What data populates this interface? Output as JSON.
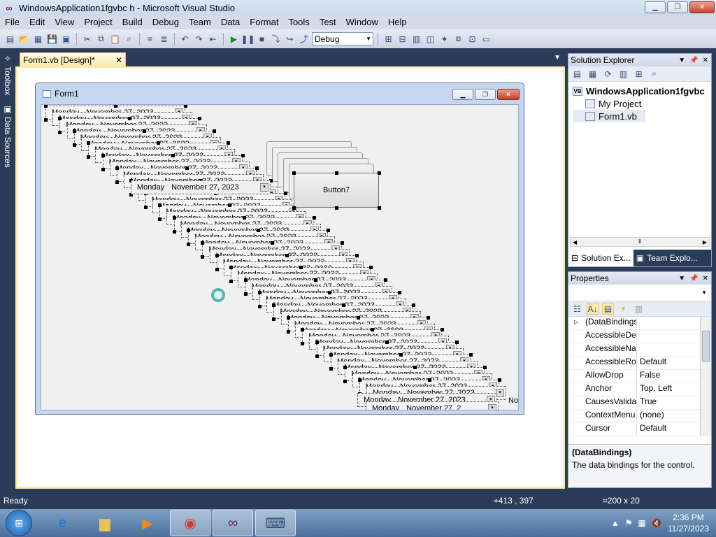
{
  "window": {
    "title": "WindowsApplication1fgvbc     h - Microsoft Visual Studio"
  },
  "menu": [
    "File",
    "Edit",
    "View",
    "Project",
    "Build",
    "Debug",
    "Team",
    "Data",
    "Format",
    "Tools",
    "Test",
    "Window",
    "Help"
  ],
  "toolbar": {
    "config_value": "Debug"
  },
  "side_tabs": {
    "toolbox": "Toolbox",
    "data_sources": "Data Sources"
  },
  "document": {
    "tab_label": "Form1.vb [Design]*"
  },
  "form": {
    "title": "Form1",
    "button_label": "Button7",
    "dtp_day": "Monday",
    "dtp_date": "November 27, 2023",
    "dtp_date_partial": "November 27, 2",
    "dtp_tail": "Nov"
  },
  "solution_explorer": {
    "title": "Solution Explorer",
    "items": [
      {
        "label": "WindowsApplication1fgvbc",
        "bold": true
      },
      {
        "label": "My Project"
      },
      {
        "label": "Form1.vb"
      }
    ],
    "tabs": [
      "Solution Ex...",
      "Team Explo..."
    ]
  },
  "properties": {
    "title": "Properties",
    "rows": [
      {
        "name": "(DataBindings",
        "value": ""
      },
      {
        "name": "AccessibleDes",
        "value": ""
      },
      {
        "name": "AccessibleNa",
        "value": ""
      },
      {
        "name": "AccessibleRol",
        "value": "Default"
      },
      {
        "name": "AllowDrop",
        "value": "False"
      },
      {
        "name": "Anchor",
        "value": "Top, Left"
      },
      {
        "name": "CausesValidat",
        "value": "True"
      },
      {
        "name": "ContextMenu",
        "value": "(none)"
      },
      {
        "name": "Cursor",
        "value": "Default"
      }
    ],
    "description_title": "(DataBindings)",
    "description_text": "The data bindings for the control."
  },
  "status": {
    "ready": "Ready",
    "position": "413 , 397",
    "size": "200 x 20"
  },
  "taskbar": {
    "time": "2:36 PM",
    "date": "11/27/2023"
  }
}
